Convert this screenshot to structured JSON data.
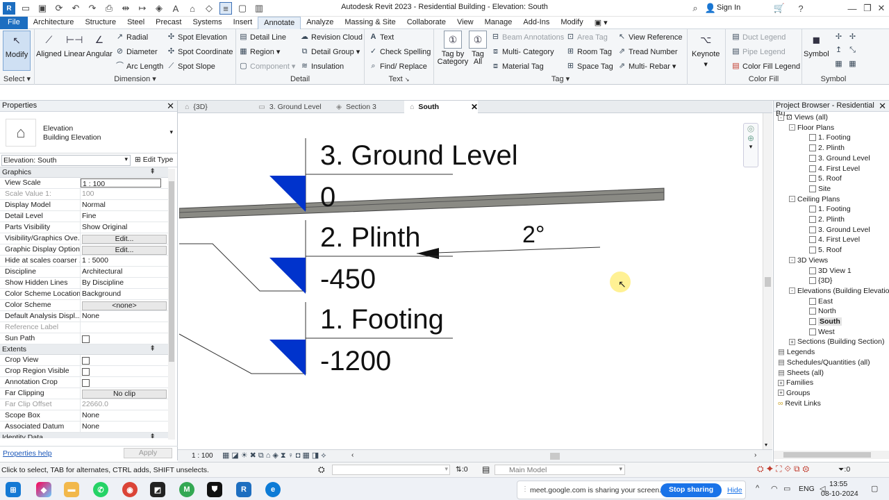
{
  "app": {
    "title": "Autodesk Revit 2023 - Residential Building - Elevation: South"
  },
  "account": {
    "sign_in": "Sign In"
  },
  "ribbon_tabs": [
    "File",
    "Architecture",
    "Structure",
    "Steel",
    "Precast",
    "Systems",
    "Insert",
    "Annotate",
    "Analyze",
    "Massing & Site",
    "Collaborate",
    "View",
    "Manage",
    "Add-Ins",
    "Modify"
  ],
  "ribbon": {
    "select": {
      "modify": "Modify",
      "label": "Select"
    },
    "dimension": {
      "aligned": "Aligned",
      "linear": "Linear",
      "angular": "Angular",
      "radial": "Radial",
      "diameter": "Diameter",
      "arc_length": "Arc  Length",
      "label": "Dimension"
    },
    "spot": {
      "elevation": "Spot  Elevation",
      "coordinate": "Spot  Coordinate",
      "slope": "Spot  Slope"
    },
    "detail": {
      "detail_line": "Detail  Line",
      "region": "Region",
      "component": "Component",
      "revision_cloud": "Revision  Cloud",
      "detail_group": "Detail  Group",
      "insulation": "Insulation",
      "label": "Detail"
    },
    "text": {
      "text": "Text",
      "check_spelling": "Check  Spelling",
      "find_replace": "Find/  Replace",
      "label": "Text"
    },
    "tag": {
      "tag_by_category_1": "Tag by",
      "tag_by_category_2": "Category",
      "tag_all_1": "Tag",
      "tag_all_2": "All",
      "beam_annotations": "Beam  Annotations",
      "multi_category": "Multi-  Category",
      "material_tag": "Material  Tag",
      "area_tag": "Area  Tag",
      "room_tag": "Room  Tag",
      "space_tag": "Space  Tag",
      "view_reference": "View  Reference",
      "tread_number": "Tread  Number",
      "multi_rebar": "Multi-  Rebar",
      "keynote": "Keynote",
      "label": "Tag"
    },
    "color_fill": {
      "duct_legend": "Duct  Legend",
      "pipe_legend": "Pipe  Legend",
      "color_fill_legend": "Color Fill  Legend",
      "label": "Color Fill"
    },
    "symbol": {
      "symbol": "Symbol",
      "label": "Symbol"
    }
  },
  "properties": {
    "title": "Properties",
    "type_family": "Elevation",
    "type_name": "Building Elevation",
    "selector": "Elevation: South",
    "edit_type": "Edit Type",
    "sections": [
      {
        "name": "Graphics",
        "rows": [
          {
            "k": "View Scale",
            "v": "1 : 100",
            "style": "input"
          },
          {
            "k": "Scale Value    1:",
            "v": "100",
            "style": "dis"
          },
          {
            "k": "Display Model",
            "v": "Normal"
          },
          {
            "k": "Detail Level",
            "v": "Fine"
          },
          {
            "k": "Parts Visibility",
            "v": "Show Original"
          },
          {
            "k": "Visibility/Graphics Ove...",
            "v": "Edit...",
            "style": "btn"
          },
          {
            "k": "Graphic Display Options",
            "v": "Edit...",
            "style": "btn"
          },
          {
            "k": "Hide at scales coarser ...",
            "v": "1 : 5000"
          },
          {
            "k": "Discipline",
            "v": "Architectural"
          },
          {
            "k": "Show Hidden Lines",
            "v": "By Discipline"
          },
          {
            "k": "Color Scheme Location",
            "v": "Background"
          },
          {
            "k": "Color Scheme",
            "v": "<none>",
            "style": "btn"
          },
          {
            "k": "Default Analysis Displ...",
            "v": "None"
          },
          {
            "k": "Reference Label",
            "v": "",
            "style": "dis"
          },
          {
            "k": "Sun Path",
            "v": "",
            "style": "check"
          }
        ]
      },
      {
        "name": "Extents",
        "rows": [
          {
            "k": "Crop View",
            "v": "",
            "style": "check"
          },
          {
            "k": "Crop Region Visible",
            "v": "",
            "style": "check"
          },
          {
            "k": "Annotation Crop",
            "v": "",
            "style": "check"
          },
          {
            "k": "Far Clipping",
            "v": "No clip",
            "style": "btn"
          },
          {
            "k": "Far Clip Offset",
            "v": "22660.0",
            "style": "dis"
          },
          {
            "k": "Scope Box",
            "v": "None"
          },
          {
            "k": "Associated Datum",
            "v": "None"
          }
        ]
      },
      {
        "name": "Identity Data",
        "rows": []
      }
    ],
    "help": "Properties help",
    "apply": "Apply"
  },
  "view_tabs": [
    {
      "label": "{3D}"
    },
    {
      "label": "3. Ground Level"
    },
    {
      "label": "Section 3"
    },
    {
      "label": "South",
      "active": true
    }
  ],
  "canvas": {
    "levels": [
      {
        "name": "3. Ground Level",
        "elev": "0"
      },
      {
        "name": "2. Plinth",
        "elev": "-450"
      },
      {
        "name": "1. Footing",
        "elev": "-1200"
      }
    ],
    "slope_label": "2°"
  },
  "view_control": {
    "scale": "1 : 100"
  },
  "browser": {
    "title": "Project Browser - Residential Bu...",
    "nodes": [
      {
        "label": "Views (all)",
        "level": 0,
        "toggle": "-",
        "icon": "views"
      },
      {
        "label": "Floor Plans",
        "level": 1,
        "toggle": "-"
      },
      {
        "label": "1. Footing",
        "level": 2
      },
      {
        "label": "2. Plinth",
        "level": 2
      },
      {
        "label": "3. Ground Level",
        "level": 2
      },
      {
        "label": "4. First Level",
        "level": 2
      },
      {
        "label": "5. Roof",
        "level": 2
      },
      {
        "label": "Site",
        "level": 2
      },
      {
        "label": "Ceiling Plans",
        "level": 1,
        "toggle": "-"
      },
      {
        "label": "1. Footing",
        "level": 2
      },
      {
        "label": "2. Plinth",
        "level": 2
      },
      {
        "label": "3. Ground Level",
        "level": 2
      },
      {
        "label": "4. First Level",
        "level": 2
      },
      {
        "label": "5. Roof",
        "level": 2
      },
      {
        "label": "3D Views",
        "level": 1,
        "toggle": "-"
      },
      {
        "label": "3D View 1",
        "level": 2
      },
      {
        "label": "{3D}",
        "level": 2
      },
      {
        "label": "Elevations (Building Elevation)",
        "level": 1,
        "toggle": "-"
      },
      {
        "label": "East",
        "level": 2
      },
      {
        "label": "North",
        "level": 2
      },
      {
        "label": "South",
        "level": 2,
        "selected": true
      },
      {
        "label": "West",
        "level": 2
      },
      {
        "label": "Sections (Building Section)",
        "level": 1,
        "toggle": "+"
      },
      {
        "label": "Legends",
        "level": 0,
        "icon": "leaf"
      },
      {
        "label": "Schedules/Quantities (all)",
        "level": 0,
        "icon": "leaf"
      },
      {
        "label": "Sheets (all)",
        "level": 0,
        "icon": "leaf"
      },
      {
        "label": "Families",
        "level": 0,
        "toggle": "+"
      },
      {
        "label": "Groups",
        "level": 0,
        "toggle": "+"
      },
      {
        "label": "Revit Links",
        "level": 0,
        "icon": "link"
      }
    ]
  },
  "status": {
    "hint": "Click to select, TAB for alternates, CTRL adds, SHIFT unselects.",
    "counter": ":0",
    "model": "Main Model",
    "filter": ":0"
  },
  "taskbar": {
    "share_msg": "meet.google.com is sharing your screen.",
    "stop_sharing": "Stop sharing",
    "hide": "Hide",
    "lang": "ENG",
    "time": "13:55",
    "date": "08-10-2024"
  },
  "colors": {
    "accent": "#1d6ec0",
    "level_head": "#0033cc",
    "floor": "#8a8a84"
  }
}
